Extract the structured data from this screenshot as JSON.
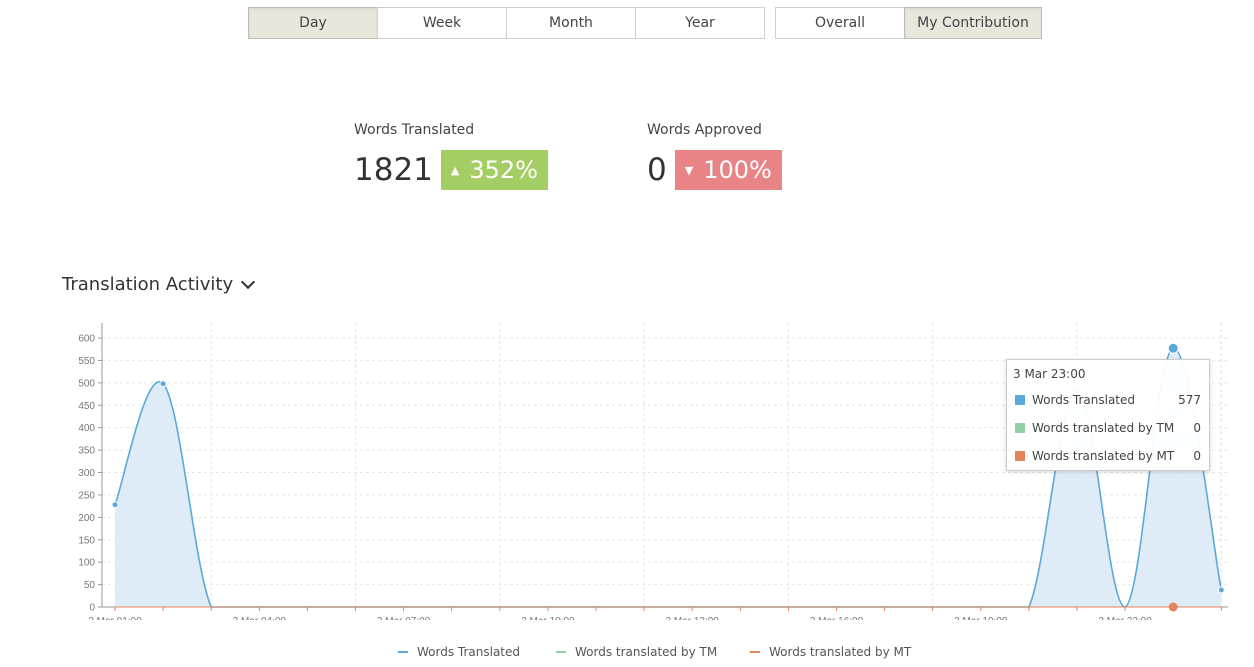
{
  "period_buttons": [
    {
      "label": "Day",
      "active": true
    },
    {
      "label": "Week",
      "active": false
    },
    {
      "label": "Month",
      "active": false
    },
    {
      "label": "Year",
      "active": false
    }
  ],
  "scope_buttons": [
    {
      "label": "Overall",
      "active": false
    },
    {
      "label": "My Contribution",
      "active": true
    }
  ],
  "stats": {
    "translated": {
      "label": "Words Translated",
      "value": "1821",
      "change": "352%",
      "direction": "up"
    },
    "approved": {
      "label": "Words Approved",
      "value": "0",
      "change": "100%",
      "direction": "down"
    }
  },
  "section": {
    "title": "Translation Activity",
    "toggle_icon": "chevron-down-icon"
  },
  "colors": {
    "translated": "#5aa9d8",
    "tm": "#8fd0a4",
    "mt": "#e5835a",
    "area": "#dbeaf6",
    "up": "#a4cd63",
    "down": "#e98486"
  },
  "chart_data": {
    "type": "area",
    "x": [
      "3 Mar 01:00",
      "3 Mar 02:00",
      "3 Mar 03:00",
      "3 Mar 04:00",
      "3 Mar 05:00",
      "3 Mar 06:00",
      "3 Mar 07:00",
      "3 Mar 08:00",
      "3 Mar 09:00",
      "3 Mar 10:00",
      "3 Mar 11:00",
      "3 Mar 12:00",
      "3 Mar 13:00",
      "3 Mar 14:00",
      "3 Mar 15:00",
      "3 Mar 16:00",
      "3 Mar 17:00",
      "3 Mar 18:00",
      "3 Mar 19:00",
      "3 Mar 20:00",
      "3 Mar 21:00",
      "3 Mar 22:00",
      "3 Mar 23:00",
      "4 Mar 00:00"
    ],
    "x_tick_labels": [
      "3 Mar 01:00",
      "3 Mar 04:00",
      "3 Mar 07:00",
      "3 Mar 10:00",
      "3 Mar 13:00",
      "3 Mar 16:00",
      "3 Mar 19:00",
      "3 Mar 22:00"
    ],
    "y_ticks": [
      0,
      50,
      100,
      150,
      200,
      250,
      300,
      350,
      400,
      450,
      500,
      550,
      600
    ],
    "ylim": [
      0,
      620
    ],
    "grid": true,
    "legend_position": "bottom",
    "series": [
      {
        "name": "Words Translated",
        "values": [
          228,
          498,
          0,
          0,
          0,
          0,
          0,
          0,
          0,
          0,
          0,
          0,
          0,
          0,
          0,
          0,
          0,
          0,
          0,
          0,
          480,
          0,
          577,
          38
        ]
      },
      {
        "name": "Words translated by TM",
        "values": [
          0,
          0,
          0,
          0,
          0,
          0,
          0,
          0,
          0,
          0,
          0,
          0,
          0,
          0,
          0,
          0,
          0,
          0,
          0,
          0,
          0,
          0,
          0,
          0
        ]
      },
      {
        "name": "Words translated by MT",
        "values": [
          0,
          0,
          0,
          0,
          0,
          0,
          0,
          0,
          0,
          0,
          0,
          0,
          0,
          0,
          0,
          0,
          0,
          0,
          0,
          0,
          0,
          0,
          0,
          0
        ]
      }
    ]
  },
  "tooltip": {
    "title": "3 Mar 23:00",
    "rows": [
      {
        "label": "Words Translated",
        "value": "577"
      },
      {
        "label": "Words translated by TM",
        "value": "0"
      },
      {
        "label": "Words translated by MT",
        "value": "0"
      }
    ]
  }
}
